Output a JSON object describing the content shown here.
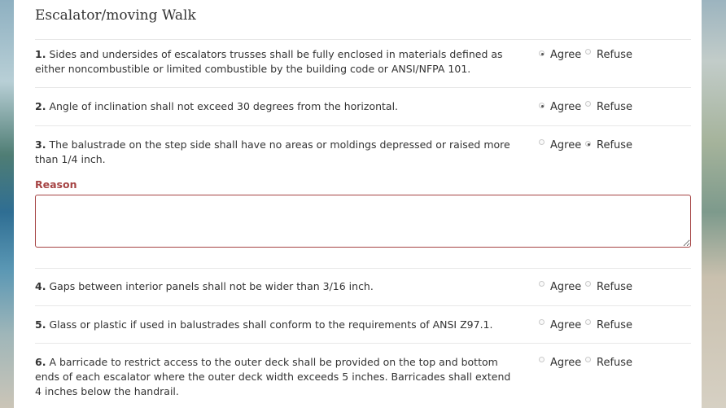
{
  "section": {
    "title": "Escalator/moving Walk"
  },
  "options": {
    "agree": "Agree",
    "refuse": "Refuse"
  },
  "questions": [
    {
      "num": "1.",
      "text": "Sides and undersides of escalators trusses shall be fully enclosed in materials defined as either noncombustible or limited combustible by the building code or ANSI/NFPA 101.",
      "selected": "agree"
    },
    {
      "num": "2.",
      "text": "Angle of inclination shall not exceed 30 degrees from the horizontal.",
      "selected": "agree"
    },
    {
      "num": "3.",
      "text": "The balustrade on the step side shall have no areas or moldings depressed or raised more than 1/4 inch.",
      "selected": "refuse"
    },
    {
      "num": "4.",
      "text": "Gaps between interior panels shall not be wider than 3/16 inch.",
      "selected": "none"
    },
    {
      "num": "5.",
      "text": "Glass or plastic if used in balustrades shall conform to the requirements of ANSI Z97.1.",
      "selected": "none"
    },
    {
      "num": "6.",
      "text": "A barricade to restrict access to the outer deck shall be provided on the top and bottom ends of each escalator where the outer deck width exceeds 5 inches. Barricades shall extend 4 inches below the handrail.",
      "selected": "none"
    }
  ],
  "reason": {
    "label": "Reason",
    "value": ""
  },
  "colors": {
    "reason_accent": "#a64444",
    "divider": "#e8e8e8"
  }
}
